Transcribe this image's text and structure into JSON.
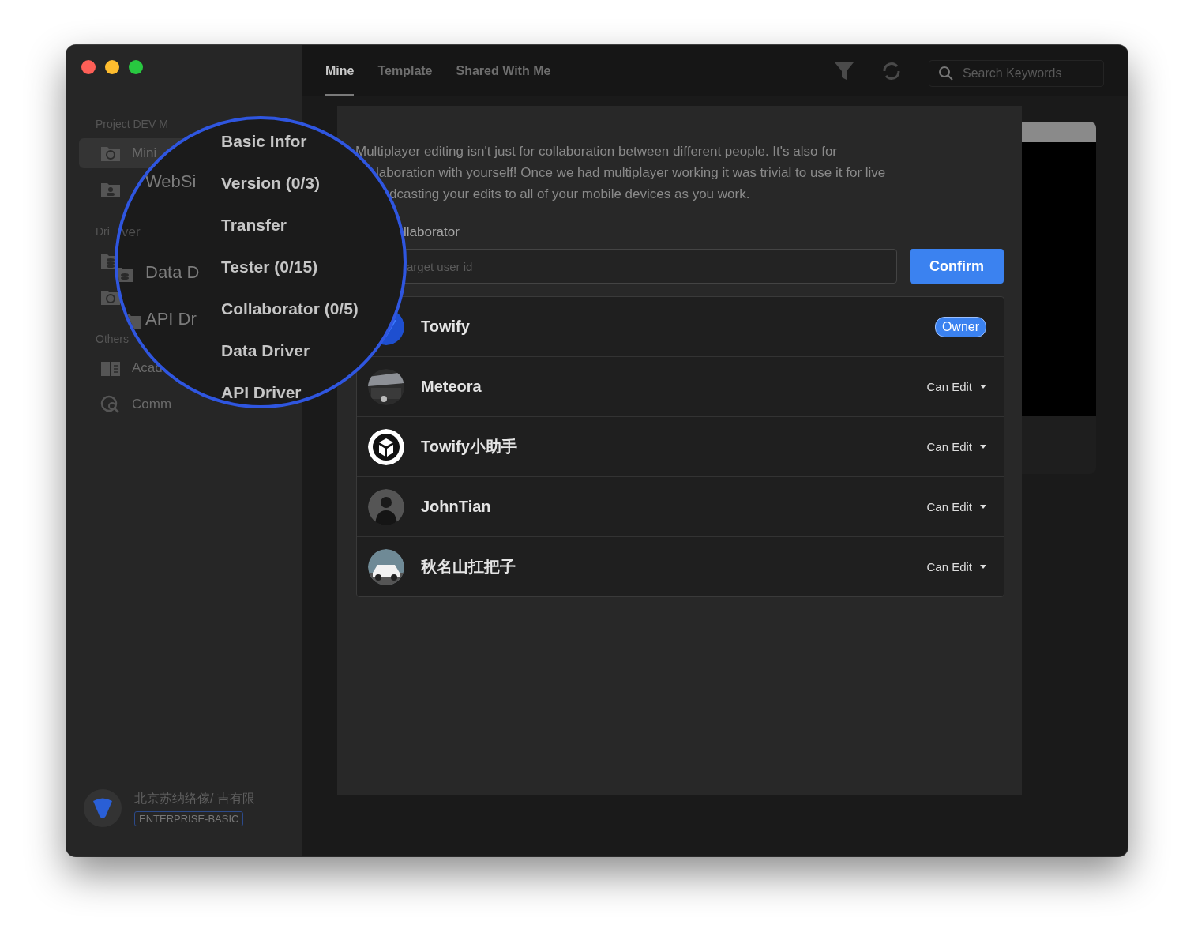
{
  "sidebar": {
    "sections": [
      {
        "title": "Project DEV M",
        "items": [
          {
            "label": "Mini",
            "selected": true
          },
          {
            "selected": false
          }
        ]
      },
      {
        "title": "Dri",
        "items": [
          {
            "selected": false
          },
          {
            "selected": false
          }
        ]
      },
      {
        "title": "Others",
        "items": [
          {
            "label": "Acad",
            "selected": false
          },
          {
            "label": "Comm",
            "selected": false
          }
        ]
      }
    ],
    "company": {
      "name": "北京苏纳络傢/ 吉有限",
      "plan": "ENTERPRISE-BASIC"
    }
  },
  "tabs": [
    {
      "label": "Mine",
      "selected": true
    },
    {
      "label": "Template",
      "selected": false
    },
    {
      "label": "Shared With Me",
      "selected": false
    }
  ],
  "search": {
    "placeholder": "Search Keywords"
  },
  "magnifier": {
    "sidebar_fragments": [
      "WebSi",
      "Data D",
      "API Dr"
    ],
    "label_fragment": "ver",
    "menu": [
      "Basic Infor",
      "Version (0/3)",
      "Transfer",
      "Tester (0/15)",
      "Collaborator (0/5)",
      "Data Driver",
      "API Driver"
    ]
  },
  "drawer": {
    "description": [
      "Multiplayer editing isn't just for collaboration between different people. It's also for",
      "laboration with yourself! Once we had multiplayer working it was trivial to use it for live",
      "dcasting your edits to all of your mobile devices as you work."
    ],
    "field_label": "llaborator",
    "input": {
      "placeholder": "arget user id"
    },
    "confirm": "Confirm",
    "members": [
      {
        "name": "Towify",
        "avatar": {
          "kind": "brand"
        },
        "role": {
          "kind": "badge",
          "label": "Owner"
        }
      },
      {
        "name": "Meteora",
        "avatar": {
          "kind": "street"
        },
        "role": {
          "kind": "dropdown",
          "label": "Can Edit"
        }
      },
      {
        "name": "Towify小助手",
        "avatar": {
          "kind": "bot"
        },
        "role": {
          "kind": "dropdown",
          "label": "Can Edit"
        }
      },
      {
        "name": "JohnTian",
        "avatar": {
          "kind": "portrait"
        },
        "role": {
          "kind": "dropdown",
          "label": "Can Edit"
        }
      },
      {
        "name": "秋名山扛把子",
        "avatar": {
          "kind": "car"
        },
        "role": {
          "kind": "dropdown",
          "label": "Can Edit"
        }
      }
    ]
  }
}
